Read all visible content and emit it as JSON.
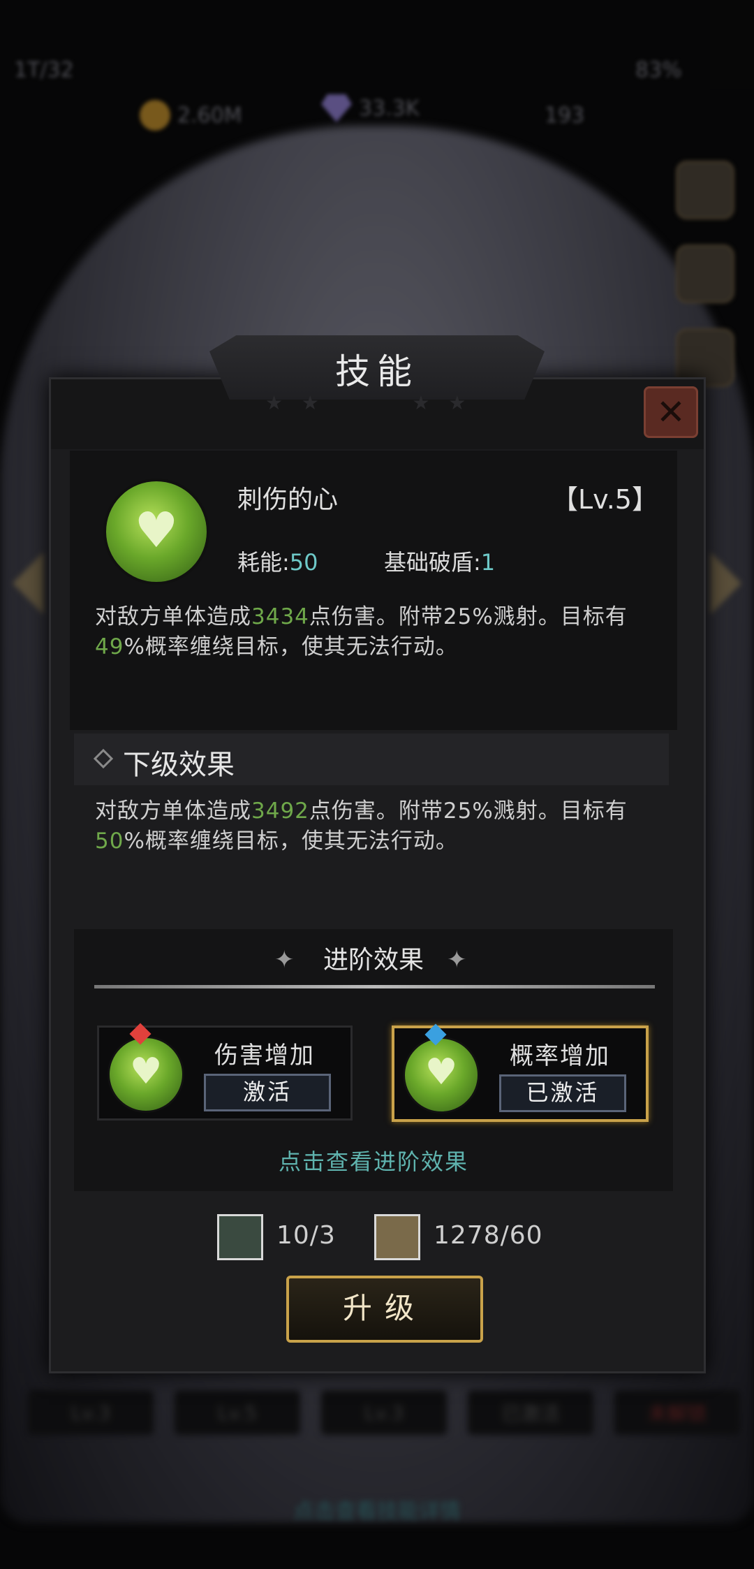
{
  "background": {
    "top_left_status": "1T/32",
    "currency_gold": "2.60M",
    "currency_gem": "33.3K",
    "currency_other": "193",
    "battery": "83%",
    "bottom_tabs": [
      "Lv.3",
      "Lv.5",
      "Lv.3",
      "已激活",
      "未解锁"
    ],
    "bottom_link": "点击查看技能详情"
  },
  "dialog": {
    "title": "技能",
    "close_icon": "close-icon"
  },
  "skill": {
    "name": "刺伤的心",
    "level": "【Lv.5】",
    "cost_label": "耗能:",
    "cost_value": "50",
    "shield_label": "基础破盾:",
    "shield_value": "1",
    "current_effect": {
      "part1": "对敌方单体造成",
      "damage": "3434",
      "part2": "点伤害。附带25%溅射。目标有",
      "chance": "49",
      "part3": "%概率缠绕目标，使其无法行动。"
    }
  },
  "next_level": {
    "title": "下级效果",
    "effect": {
      "part1": "对敌方单体造成",
      "damage": "3492",
      "part2": "点伤害。附带25%溅射。目标有",
      "chance": "50",
      "part3": "%概率缠绕目标，使其无法行动。"
    }
  },
  "advanced": {
    "title": "进阶效果",
    "options": [
      {
        "name": "伤害增加",
        "button": "激活",
        "gem_color": "#e0413c",
        "active": false
      },
      {
        "name": "概率增加",
        "button": "已激活",
        "gem_color": "#3aa0e0",
        "active": true
      }
    ],
    "view_link": "点击查看进阶效果"
  },
  "resources": [
    {
      "icon": "book-icon",
      "amount": "10/3"
    },
    {
      "icon": "scroll-icon",
      "amount": "1278/60"
    }
  ],
  "upgrade_button": "升级",
  "colors": {
    "accent_gold": "#c9a24a",
    "number_teal": "#6ec9c8",
    "number_green": "#6fa84a",
    "link_teal": "#5fb3ae"
  }
}
